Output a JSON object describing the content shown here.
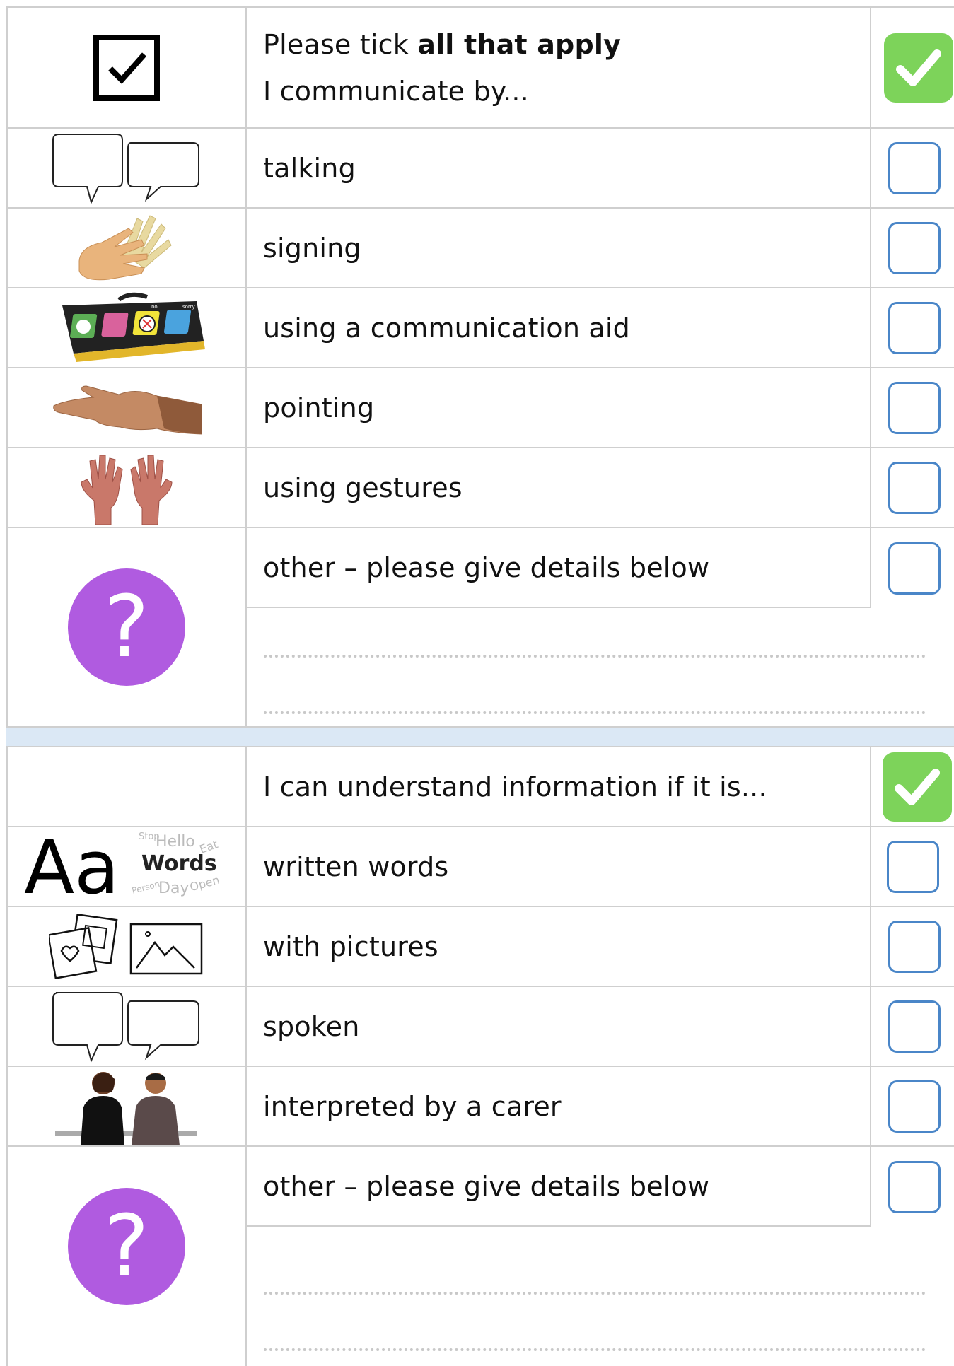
{
  "section1": {
    "header_line1_prefix": "Please tick ",
    "header_line1_bold": "all that apply",
    "header_line2": "I communicate by...",
    "items": [
      {
        "label": "talking",
        "icon": "speech-bubbles-icon"
      },
      {
        "label": "signing",
        "icon": "signing-hands-icon"
      },
      {
        "label": "using a communication aid",
        "icon": "communication-aid-icon"
      },
      {
        "label": "pointing",
        "icon": "pointing-hand-icon"
      },
      {
        "label": "using gestures",
        "icon": "open-hands-icon"
      },
      {
        "label": "other – please give details below",
        "icon": "question-mark-icon"
      }
    ]
  },
  "section2": {
    "header": "I can understand information if it is...",
    "items": [
      {
        "label": "written words",
        "icon": "written-words-icon"
      },
      {
        "label": "with pictures",
        "icon": "pictures-icon"
      },
      {
        "label": "spoken",
        "icon": "speech-bubbles-icon"
      },
      {
        "label": "interpreted by a carer",
        "icon": "carer-conversation-icon"
      },
      {
        "label": "other – please give details below",
        "icon": "question-mark-icon"
      }
    ]
  },
  "question_mark": "?",
  "words_icon": {
    "aa": "Aa",
    "words": "Words",
    "scatter": [
      "Stop",
      "Hello",
      "Eat",
      "Person",
      "Day",
      "Open"
    ]
  },
  "aid_labels": [
    "no",
    "sorry"
  ],
  "colors": {
    "checkbox_border": "#4a86c8",
    "green_tick": "#7dd35a",
    "question_circle": "#b05be0",
    "divider": "#dbe8f5"
  }
}
